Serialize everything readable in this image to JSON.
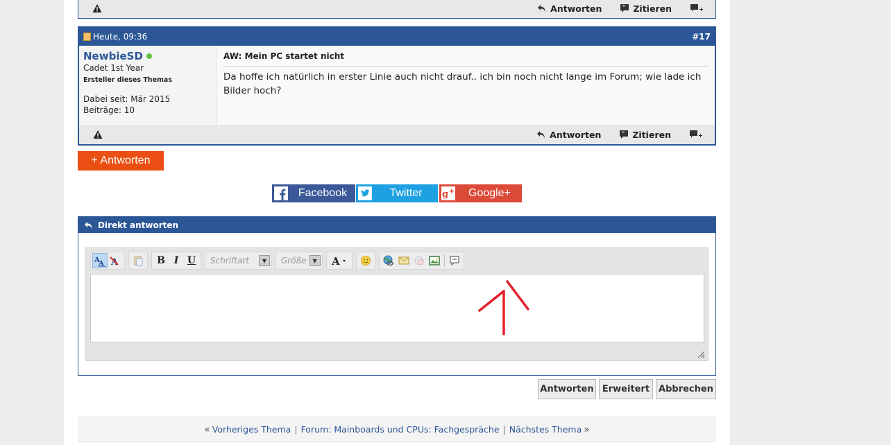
{
  "post17": {
    "date": "Heute, 09:36",
    "number": "#17",
    "user": {
      "name": "NewbieSD",
      "rank": "Cadet 1st Year",
      "starter": "Ersteller dieses Themas",
      "joined": "Dabei seit: Mär 2015",
      "posts": "Beiträge: 10"
    },
    "title": "AW: Mein PC startet nicht",
    "text": "Da hoffe ich natürlich in erster Linie auch nicht drauf.. ich bin noch nicht lange im Forum; wie lade ich Bilder hoch?"
  },
  "actions": {
    "reply": "Antworten",
    "quote": "Zitieren"
  },
  "reply_button": "+ Antworten",
  "social": {
    "facebook": "Facebook",
    "twitter": "Twitter",
    "google": "Google+"
  },
  "quick_reply": {
    "title": "Direkt antworten",
    "font_placeholder": "Schriftart",
    "size_placeholder": "Größe"
  },
  "buttons": {
    "submit": "Antworten",
    "advanced": "Erweitert",
    "cancel": "Abbrechen"
  },
  "nav": {
    "prev": "Vorheriges Thema",
    "forum": "Forum: Mainboards und CPUs: Fachgespräche",
    "next": "Nächstes Thema",
    "sep": "|",
    "lquote": "«",
    "rquote": "»"
  },
  "colors": {
    "header_blue": "#2b5797",
    "reply_orange": "#ea4e12",
    "facebook": "#3b5998",
    "twitter": "#1da1e2",
    "google": "#dc4a38",
    "annotation_red": "#e0202a"
  }
}
